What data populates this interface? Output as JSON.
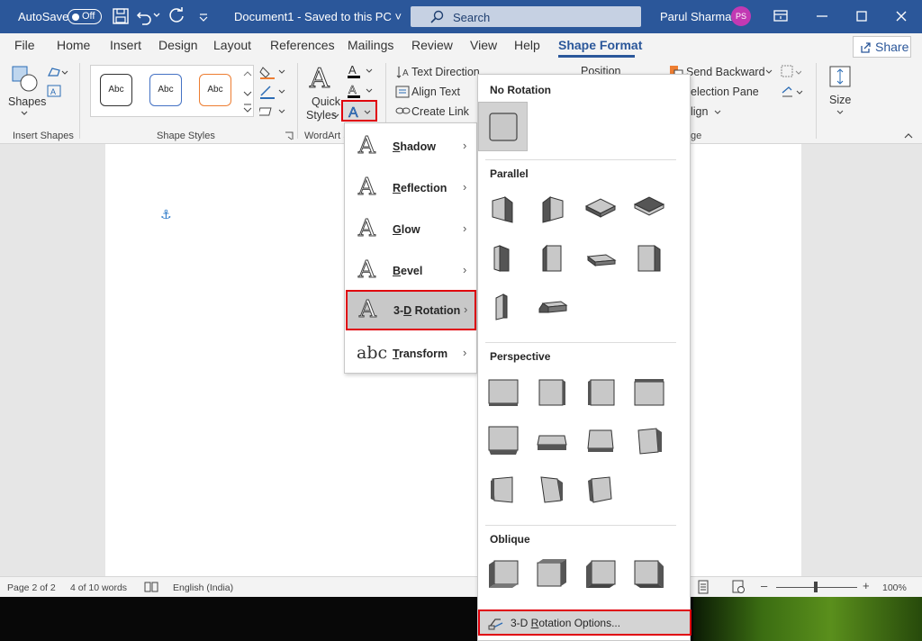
{
  "titlebar": {
    "autosave_label": "AutoSave",
    "autosave_state": "Off",
    "doc_name": "Document1  -  Saved to this PC  ˅",
    "search_placeholder": "Search",
    "user_name": "Parul Sharma",
    "user_initials": "PS",
    "accent": "#2b579a"
  },
  "menu": {
    "tabs": [
      "File",
      "Home",
      "Insert",
      "Design",
      "Layout",
      "References",
      "Mailings",
      "Review",
      "View",
      "Help",
      "Shape Format"
    ],
    "active_tab": "Shape Format",
    "share_label": "Share"
  },
  "ribbon": {
    "insert_shapes": {
      "shapes_label": "Shapes",
      "group_label": "Insert Shapes"
    },
    "shape_styles": {
      "style_labels": [
        "Abc",
        "Abc",
        "Abc"
      ],
      "group_label": "Shape Styles"
    },
    "wordart": {
      "quick_styles_label": "Quick",
      "quick_styles_label2": "Styles",
      "group_label": "WordArt S"
    },
    "text": {
      "text_direction": "Text Direction",
      "align_text": "Align Text",
      "create_link": "Create Link"
    },
    "arrange": {
      "position": "Position",
      "send_backward": "Send Backward",
      "selection_pane": "election Pane",
      "align": "lign",
      "group_label": "ge"
    },
    "size": {
      "label": "Size"
    }
  },
  "text_effects_menu": {
    "items": [
      {
        "glyph": "A",
        "label": "Shadow",
        "underline": "S",
        "rest": "hadow"
      },
      {
        "glyph": "A",
        "label": "Reflection",
        "underline": "R",
        "rest": "eflection"
      },
      {
        "glyph": "A",
        "label": "Glow",
        "underline": "G",
        "rest": "low"
      },
      {
        "glyph": "A",
        "label": "Bevel",
        "underline": "B",
        "rest": "evel"
      },
      {
        "glyph": "A",
        "label": "3-D Rotation",
        "pre": "3-",
        "underline": "D",
        "rest": " Rotation"
      },
      {
        "glyph": "abc",
        "label": "Transform",
        "underline": "T",
        "rest": "ransform"
      }
    ],
    "selected": "3-D Rotation"
  },
  "rotation_gallery": {
    "sections": [
      "No Rotation",
      "Parallel",
      "Perspective",
      "Oblique"
    ],
    "options_label_pre": "3-D ",
    "options_label_ul": "R",
    "options_label_rest": "otation Options..."
  },
  "statusbar": {
    "page": "Page 2 of 2",
    "words": "4 of 10 words",
    "language": "English (India)",
    "zoom": "100%"
  }
}
